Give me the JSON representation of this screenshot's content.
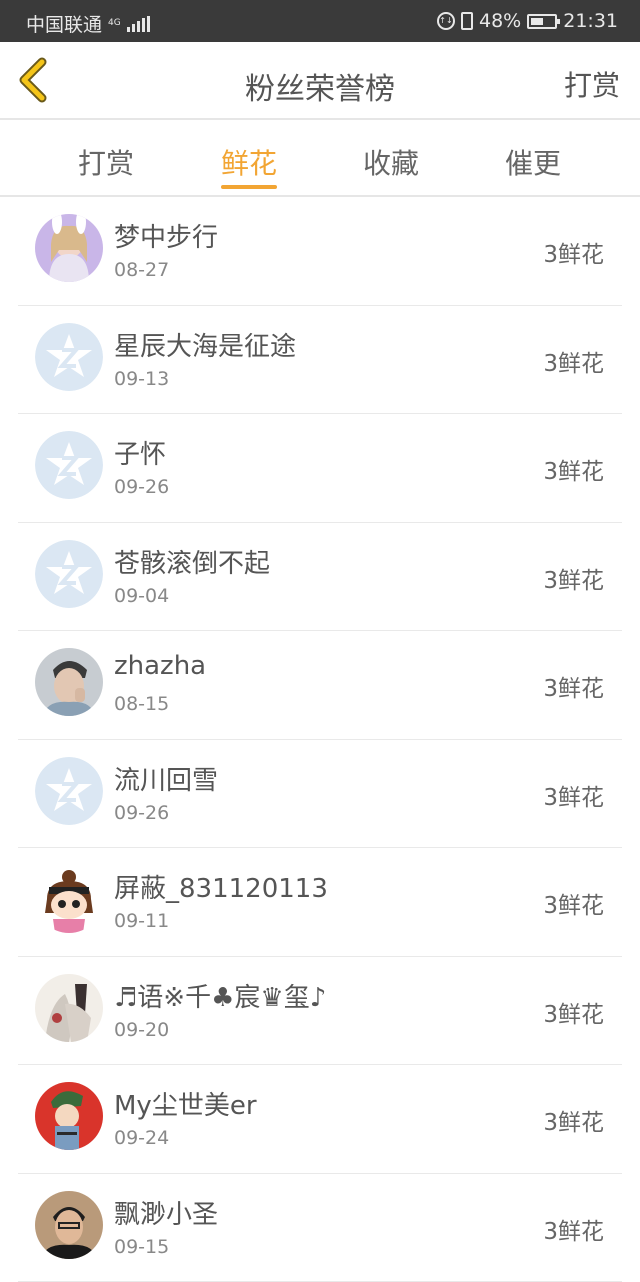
{
  "status_bar": {
    "carrier": "中国联通",
    "network": "4G",
    "battery": "48%",
    "time": "21:31"
  },
  "header": {
    "title": "粉丝荣誉榜",
    "right_action": "打赏"
  },
  "tabs": [
    {
      "label": "打赏",
      "active": false
    },
    {
      "label": "鲜花",
      "active": true
    },
    {
      "label": "收藏",
      "active": false
    },
    {
      "label": "催更",
      "active": false
    }
  ],
  "colors": {
    "accent": "#f2a533",
    "status_bar_bg": "#3a3a3a"
  },
  "rows": [
    {
      "name": "梦中步行",
      "date": "08-27",
      "count": "3鲜花",
      "avatar": "photo-girl"
    },
    {
      "name": "星辰大海是征途",
      "date": "09-13",
      "count": "3鲜花",
      "avatar": "default-z"
    },
    {
      "name": "子怀",
      "date": "09-26",
      "count": "3鲜花",
      "avatar": "default-z"
    },
    {
      "name": "苍骸滚倒不起",
      "date": "09-04",
      "count": "3鲜花",
      "avatar": "default-z"
    },
    {
      "name": "zhazha",
      "date": "08-15",
      "count": "3鲜花",
      "avatar": "photo-man"
    },
    {
      "name": "流川回雪",
      "date": "09-26",
      "count": "3鲜花",
      "avatar": "default-z"
    },
    {
      "name": "屏蔽_831120113",
      "date": "09-11",
      "count": "3鲜花",
      "avatar": "cartoon"
    },
    {
      "name": "♬语※千♣宸♛玺♪",
      "date": "09-20",
      "count": "3鲜花",
      "avatar": "artwork"
    },
    {
      "name": "My尘世美er",
      "date": "09-24",
      "count": "3鲜花",
      "avatar": "red-cartoon"
    },
    {
      "name": "飘渺小圣",
      "date": "09-15",
      "count": "3鲜花",
      "avatar": "photo-man2"
    }
  ]
}
